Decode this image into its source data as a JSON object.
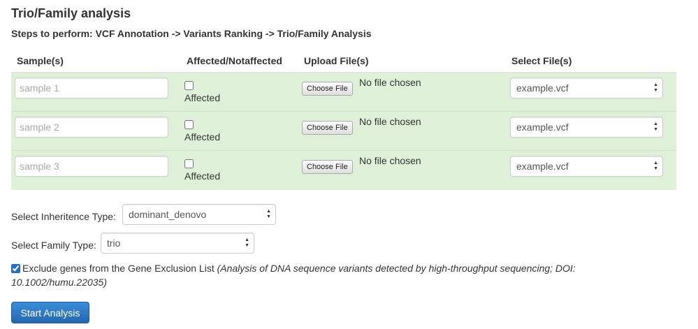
{
  "title": "Trio/Family analysis",
  "steps": "Steps to perform: VCF Annotation -> Variants Ranking -> Trio/Family Analysis",
  "table": {
    "headers": [
      "Sample(s)",
      "Affected/Notaffected",
      "Upload File(s)",
      "Select File(s)"
    ],
    "rows": [
      {
        "sample_placeholder": "sample 1",
        "affected_label": "Affected",
        "choose_label": "Choose File",
        "file_status": "No file chosen",
        "selected_file": "example.vcf"
      },
      {
        "sample_placeholder": "sample 2",
        "affected_label": "Affected",
        "choose_label": "Choose File",
        "file_status": "No file chosen",
        "selected_file": "example.vcf"
      },
      {
        "sample_placeholder": "sample 3",
        "affected_label": "Affected",
        "choose_label": "Choose File",
        "file_status": "No file chosen",
        "selected_file": "example.vcf"
      }
    ]
  },
  "inheritance": {
    "label": "Select Inheritence Type:",
    "value": "dominant_denovo"
  },
  "family": {
    "label": "Select Family Type:",
    "value": "trio"
  },
  "exclusion": {
    "label": "Exclude genes from the Gene Exclusion List",
    "citation": "(Analysis of DNA sequence variants detected by high-throughput sequencing; DOI: 10.1002/humu.22035)",
    "checked": true
  },
  "start_button": "Start Analysis",
  "colors": {
    "row_bg": "#dff0d8",
    "primary": "#2a6ebb"
  }
}
